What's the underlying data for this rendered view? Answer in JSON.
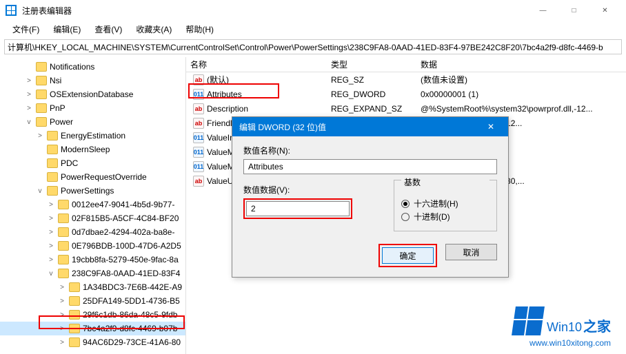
{
  "window": {
    "title": "注册表编辑器",
    "min": "—",
    "max": "□",
    "close": "✕"
  },
  "menu": {
    "file": "文件(F)",
    "edit": "编辑(E)",
    "view": "查看(V)",
    "favorites": "收藏夹(A)",
    "help": "帮助(H)"
  },
  "address": "计算机\\HKEY_LOCAL_MACHINE\\SYSTEM\\CurrentControlSet\\Control\\Power\\PowerSettings\\238C9FA8-0AAD-41ED-83F4-97BE242C8F20\\7bc4a2f9-d8fc-4469-b",
  "tree": [
    {
      "indent": 2,
      "exp": "",
      "label": "Notifications"
    },
    {
      "indent": 2,
      "exp": ">",
      "label": "Nsi"
    },
    {
      "indent": 2,
      "exp": ">",
      "label": "OSExtensionDatabase"
    },
    {
      "indent": 2,
      "exp": ">",
      "label": "PnP"
    },
    {
      "indent": 2,
      "exp": "v",
      "label": "Power"
    },
    {
      "indent": 3,
      "exp": ">",
      "label": "EnergyEstimation"
    },
    {
      "indent": 3,
      "exp": "",
      "label": "ModernSleep"
    },
    {
      "indent": 3,
      "exp": "",
      "label": "PDC"
    },
    {
      "indent": 3,
      "exp": "",
      "label": "PowerRequestOverride"
    },
    {
      "indent": 3,
      "exp": "v",
      "label": "PowerSettings"
    },
    {
      "indent": 4,
      "exp": ">",
      "label": "0012ee47-9041-4b5d-9b77-"
    },
    {
      "indent": 4,
      "exp": ">",
      "label": "02F815B5-A5CF-4C84-BF20"
    },
    {
      "indent": 4,
      "exp": ">",
      "label": "0d7dbae2-4294-402a-ba8e-"
    },
    {
      "indent": 4,
      "exp": ">",
      "label": "0E796BDB-100D-47D6-A2D5"
    },
    {
      "indent": 4,
      "exp": ">",
      "label": "19cbb8fa-5279-450e-9fac-8a"
    },
    {
      "indent": 4,
      "exp": "v",
      "label": "238C9FA8-0AAD-41ED-83F4"
    },
    {
      "indent": 4,
      "exp": ">",
      "label": "1A34BDC3-7E6B-442E-A9",
      "sub": true
    },
    {
      "indent": 4,
      "exp": ">",
      "label": "25DFA149-5DD1-4736-B5",
      "sub": true
    },
    {
      "indent": 4,
      "exp": ">",
      "label": "29f6c1db-86da-48c5-9fdb",
      "sub": true
    },
    {
      "indent": 4,
      "exp": ">",
      "label": "7bc4a2f9-d8fc-4469-b07b",
      "sub": true,
      "selected": true
    },
    {
      "indent": 4,
      "exp": ">",
      "label": "94AC6D29-73CE-41A6-80",
      "sub": true
    }
  ],
  "list": {
    "head": {
      "name": "名称",
      "type": "类型",
      "data": "数据"
    },
    "rows": [
      {
        "icon": "str",
        "name": "(默认)",
        "type": "REG_SZ",
        "data": "(数值未设置)"
      },
      {
        "icon": "dw",
        "name": "Attributes",
        "type": "REG_DWORD",
        "data": "0x00000001 (1)",
        "hl": true
      },
      {
        "icon": "str",
        "name": "Description",
        "type": "REG_EXPAND_SZ",
        "data": "@%SystemRoot%\\system32\\powrprof.dll,-12..."
      },
      {
        "icon": "str",
        "name": "FriendlyN",
        "type": "",
        "data": "system32\\powrprof.dll,-12..."
      },
      {
        "icon": "dw",
        "name": "ValueInc",
        "type": "",
        "data": ""
      },
      {
        "icon": "dw",
        "name": "ValueM",
        "type": "",
        "data": ""
      },
      {
        "icon": "dw",
        "name": "ValueM",
        "type": "",
        "data": ""
      },
      {
        "icon": "str",
        "name": "ValueUn",
        "type": "",
        "data": "system32\\powrprof.dll,-80,..."
      }
    ]
  },
  "dialog": {
    "title": "编辑 DWORD (32 位)值",
    "name_label": "数值名称(N):",
    "name_value": "Attributes",
    "data_label": "数值数据(V):",
    "data_value": "2",
    "base_label": "基数",
    "hex": "十六进制(H)",
    "dec": "十进制(D)",
    "ok": "确定",
    "cancel": "取消"
  },
  "watermark": {
    "brand_en": "Win10",
    "brand_zh": "之家",
    "url": "www.win10xitong.com"
  }
}
